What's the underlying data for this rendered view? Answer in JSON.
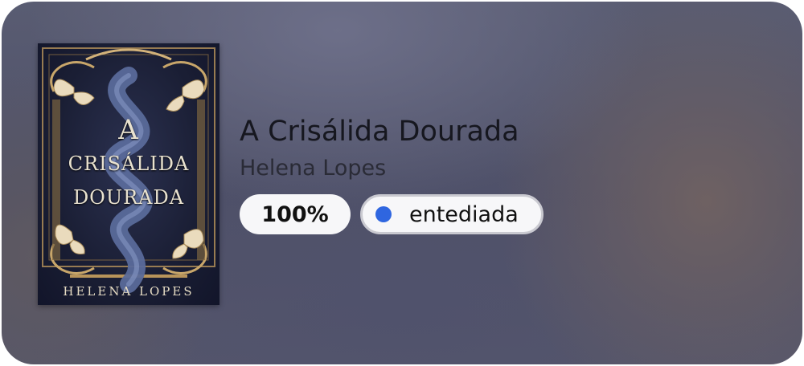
{
  "book": {
    "title": "A Crisálida Dourada",
    "author": "Helena Lopes",
    "cover": {
      "title_line1": "A",
      "title_line2": "CRISÁLIDA",
      "title_line3": "DOURADA",
      "author": "HELENA LOPES"
    },
    "progress_label": "100%",
    "status": {
      "label": "entediada",
      "dot_color": "#2f66e0"
    }
  }
}
